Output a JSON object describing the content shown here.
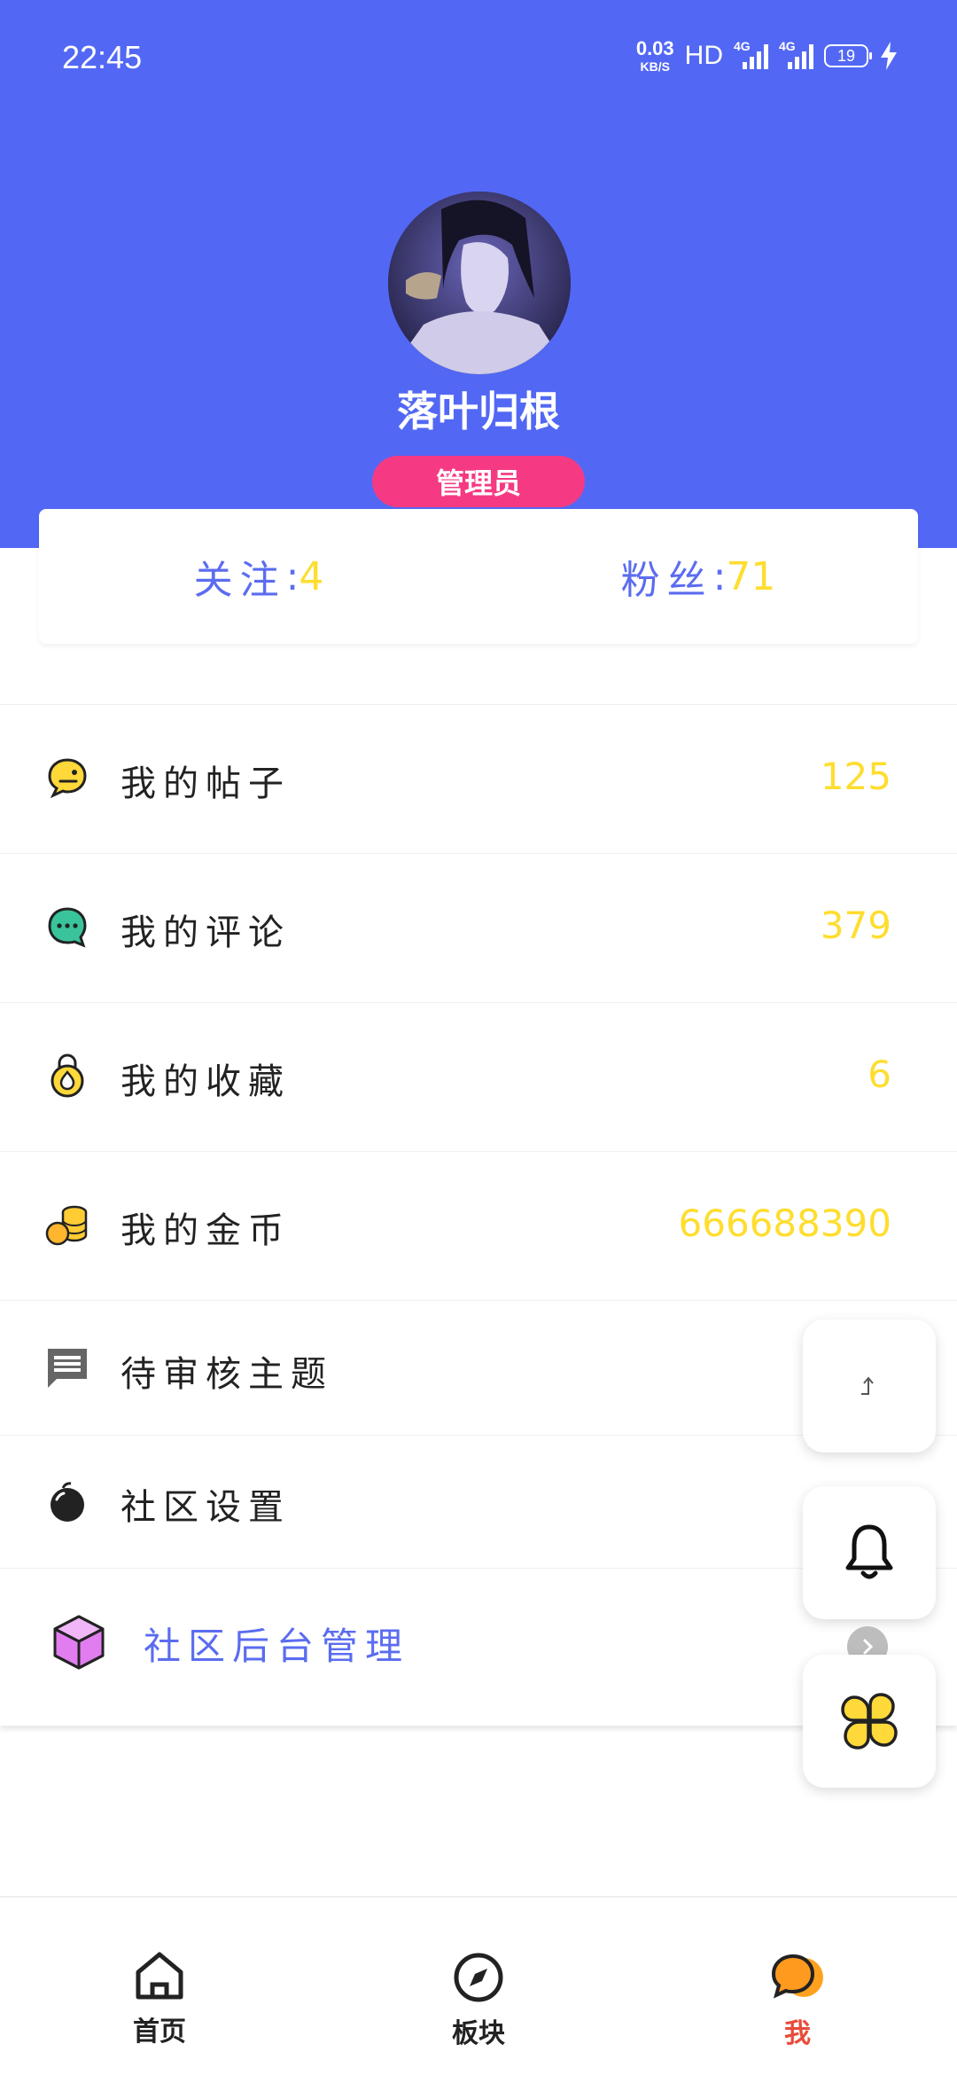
{
  "status_bar": {
    "time": "22:45",
    "net_speed_value": "0.03",
    "net_speed_unit": "KB/S",
    "hd": "HD",
    "sim1_tag": "4G",
    "sim2_tag": "4G",
    "battery": "19"
  },
  "profile": {
    "username": "落叶归根",
    "role": "管理员"
  },
  "follow": {
    "following_label": "关注",
    "following_sep": ":",
    "following_count": "4",
    "fans_label": "粉丝",
    "fans_sep": ":",
    "fans_count": "71"
  },
  "menu": {
    "posts": {
      "label": "我的帖子",
      "count": "125"
    },
    "comments": {
      "label": "我的评论",
      "count": "379"
    },
    "favorites": {
      "label": "我的收藏",
      "count": "6"
    },
    "coins": {
      "label": "我的金币",
      "count": "666688390"
    },
    "pending": {
      "label": "待审核主题"
    },
    "settings": {
      "label": "社区设置"
    },
    "admin": {
      "label": "社区后台管理"
    }
  },
  "bottom_nav": {
    "home": "首页",
    "boards": "板块",
    "me": "我"
  },
  "colors": {
    "header_bg": "#5268f4",
    "accent_blue": "#5b6cf0",
    "count_yellow": "#ffdd2e",
    "badge_pink": "#f53a83",
    "active_tab": "#e94b3a"
  },
  "icons": {
    "posts": "chat-face-icon",
    "comments": "chat-dots-icon",
    "favorites": "lock-star-icon",
    "coins": "coin-stack-icon",
    "pending": "message-icon",
    "settings": "bomb-icon",
    "admin": "cube-icon",
    "fab1": "share-arrow-icon",
    "fab2": "bell-icon",
    "fab3": "clover-icon",
    "nav_home": "home-icon",
    "nav_boards": "compass-icon",
    "nav_me": "chat-bubble-icon"
  }
}
